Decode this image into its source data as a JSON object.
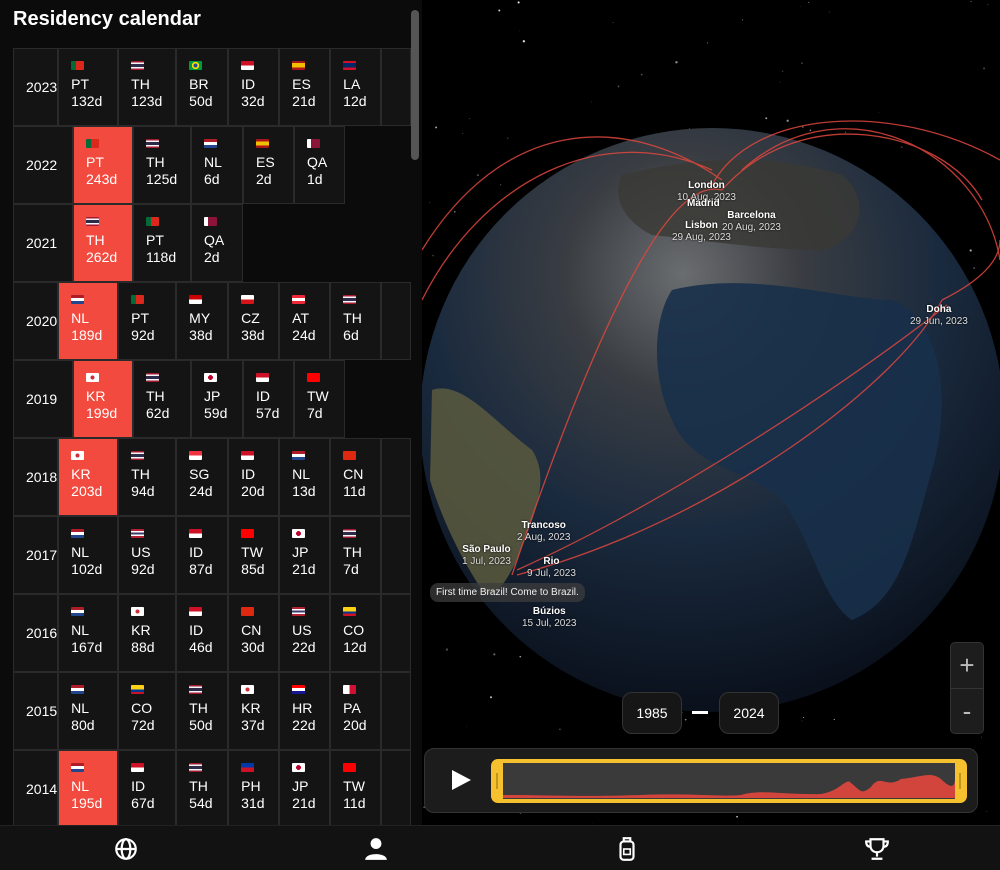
{
  "title": "Residency calendar",
  "rows": [
    {
      "year": "2023",
      "cells": [
        {
          "code": "PT",
          "days": "132d"
        },
        {
          "code": "TH",
          "days": "123d"
        },
        {
          "code": "BR",
          "days": "50d"
        },
        {
          "code": "ID",
          "days": "32d"
        },
        {
          "code": "ES",
          "days": "21d"
        },
        {
          "code": "LA",
          "days": "12d"
        }
      ]
    },
    {
      "year": "2022",
      "cells": [
        {
          "code": "PT",
          "days": "243d",
          "highlight": true
        },
        {
          "code": "TH",
          "days": "125d"
        },
        {
          "code": "NL",
          "days": "6d"
        },
        {
          "code": "ES",
          "days": "2d"
        },
        {
          "code": "QA",
          "days": "1d"
        }
      ]
    },
    {
      "year": "2021",
      "cells": [
        {
          "code": "TH",
          "days": "262d",
          "highlight": true
        },
        {
          "code": "PT",
          "days": "118d"
        },
        {
          "code": "QA",
          "days": "2d"
        }
      ]
    },
    {
      "year": "2020",
      "cells": [
        {
          "code": "NL",
          "days": "189d",
          "highlight": true
        },
        {
          "code": "PT",
          "days": "92d"
        },
        {
          "code": "MY",
          "days": "38d"
        },
        {
          "code": "CZ",
          "days": "38d"
        },
        {
          "code": "AT",
          "days": "24d"
        },
        {
          "code": "TH",
          "days": "6d"
        }
      ]
    },
    {
      "year": "2019",
      "cells": [
        {
          "code": "KR",
          "days": "199d",
          "highlight": true
        },
        {
          "code": "TH",
          "days": "62d"
        },
        {
          "code": "JP",
          "days": "59d"
        },
        {
          "code": "ID",
          "days": "57d"
        },
        {
          "code": "TW",
          "days": "7d"
        }
      ]
    },
    {
      "year": "2018",
      "cells": [
        {
          "code": "KR",
          "days": "203d",
          "highlight": true
        },
        {
          "code": "TH",
          "days": "94d"
        },
        {
          "code": "SG",
          "days": "24d"
        },
        {
          "code": "ID",
          "days": "20d"
        },
        {
          "code": "NL",
          "days": "13d"
        },
        {
          "code": "CN",
          "days": "11d"
        }
      ]
    },
    {
      "year": "2017",
      "cells": [
        {
          "code": "NL",
          "days": "102d"
        },
        {
          "code": "US",
          "days": "92d"
        },
        {
          "code": "ID",
          "days": "87d"
        },
        {
          "code": "TW",
          "days": "85d"
        },
        {
          "code": "JP",
          "days": "21d"
        },
        {
          "code": "TH",
          "days": "7d"
        }
      ]
    },
    {
      "year": "2016",
      "cells": [
        {
          "code": "NL",
          "days": "167d"
        },
        {
          "code": "KR",
          "days": "88d"
        },
        {
          "code": "ID",
          "days": "46d"
        },
        {
          "code": "CN",
          "days": "30d"
        },
        {
          "code": "US",
          "days": "22d"
        },
        {
          "code": "CO",
          "days": "12d"
        }
      ]
    },
    {
      "year": "2015",
      "cells": [
        {
          "code": "NL",
          "days": "80d"
        },
        {
          "code": "CO",
          "days": "72d"
        },
        {
          "code": "TH",
          "days": "50d"
        },
        {
          "code": "KR",
          "days": "37d"
        },
        {
          "code": "HR",
          "days": "22d"
        },
        {
          "code": "PA",
          "days": "20d"
        }
      ]
    },
    {
      "year": "2014",
      "cells": [
        {
          "code": "NL",
          "days": "195d",
          "highlight": true
        },
        {
          "code": "ID",
          "days": "67d"
        },
        {
          "code": "TH",
          "days": "54d"
        },
        {
          "code": "PH",
          "days": "31d"
        },
        {
          "code": "JP",
          "days": "21d"
        },
        {
          "code": "TW",
          "days": "11d"
        }
      ]
    }
  ],
  "globe": {
    "labels": [
      {
        "city": "London",
        "date": "10 Aug, 2023"
      },
      {
        "city": "Lisbon",
        "date": "29 Aug, 2023"
      },
      {
        "city": "Madrid",
        "date": ""
      },
      {
        "city": "Barcelona",
        "date": "20 Aug, 2023"
      },
      {
        "city": "Doha",
        "date": "29 Jun, 2023"
      },
      {
        "city": "Trancoso",
        "date": "2 Aug, 2023"
      },
      {
        "city": "São Paulo",
        "date": "1 Jul, 2023"
      },
      {
        "city": "Rio",
        "date": "9 Jul, 2023"
      },
      {
        "city": "Búzios",
        "date": "15 Jul, 2023"
      }
    ],
    "note": "First time Brazil! Come to Brazil."
  },
  "range": {
    "start": "1985",
    "end": "2024"
  },
  "zoom": {
    "plus": "+",
    "minus": "-"
  },
  "nav": [
    "globe",
    "profile",
    "luggage",
    "trophy"
  ],
  "colors": {
    "highlight": "#f24a3e",
    "timeline_frame": "#f5c12e"
  }
}
